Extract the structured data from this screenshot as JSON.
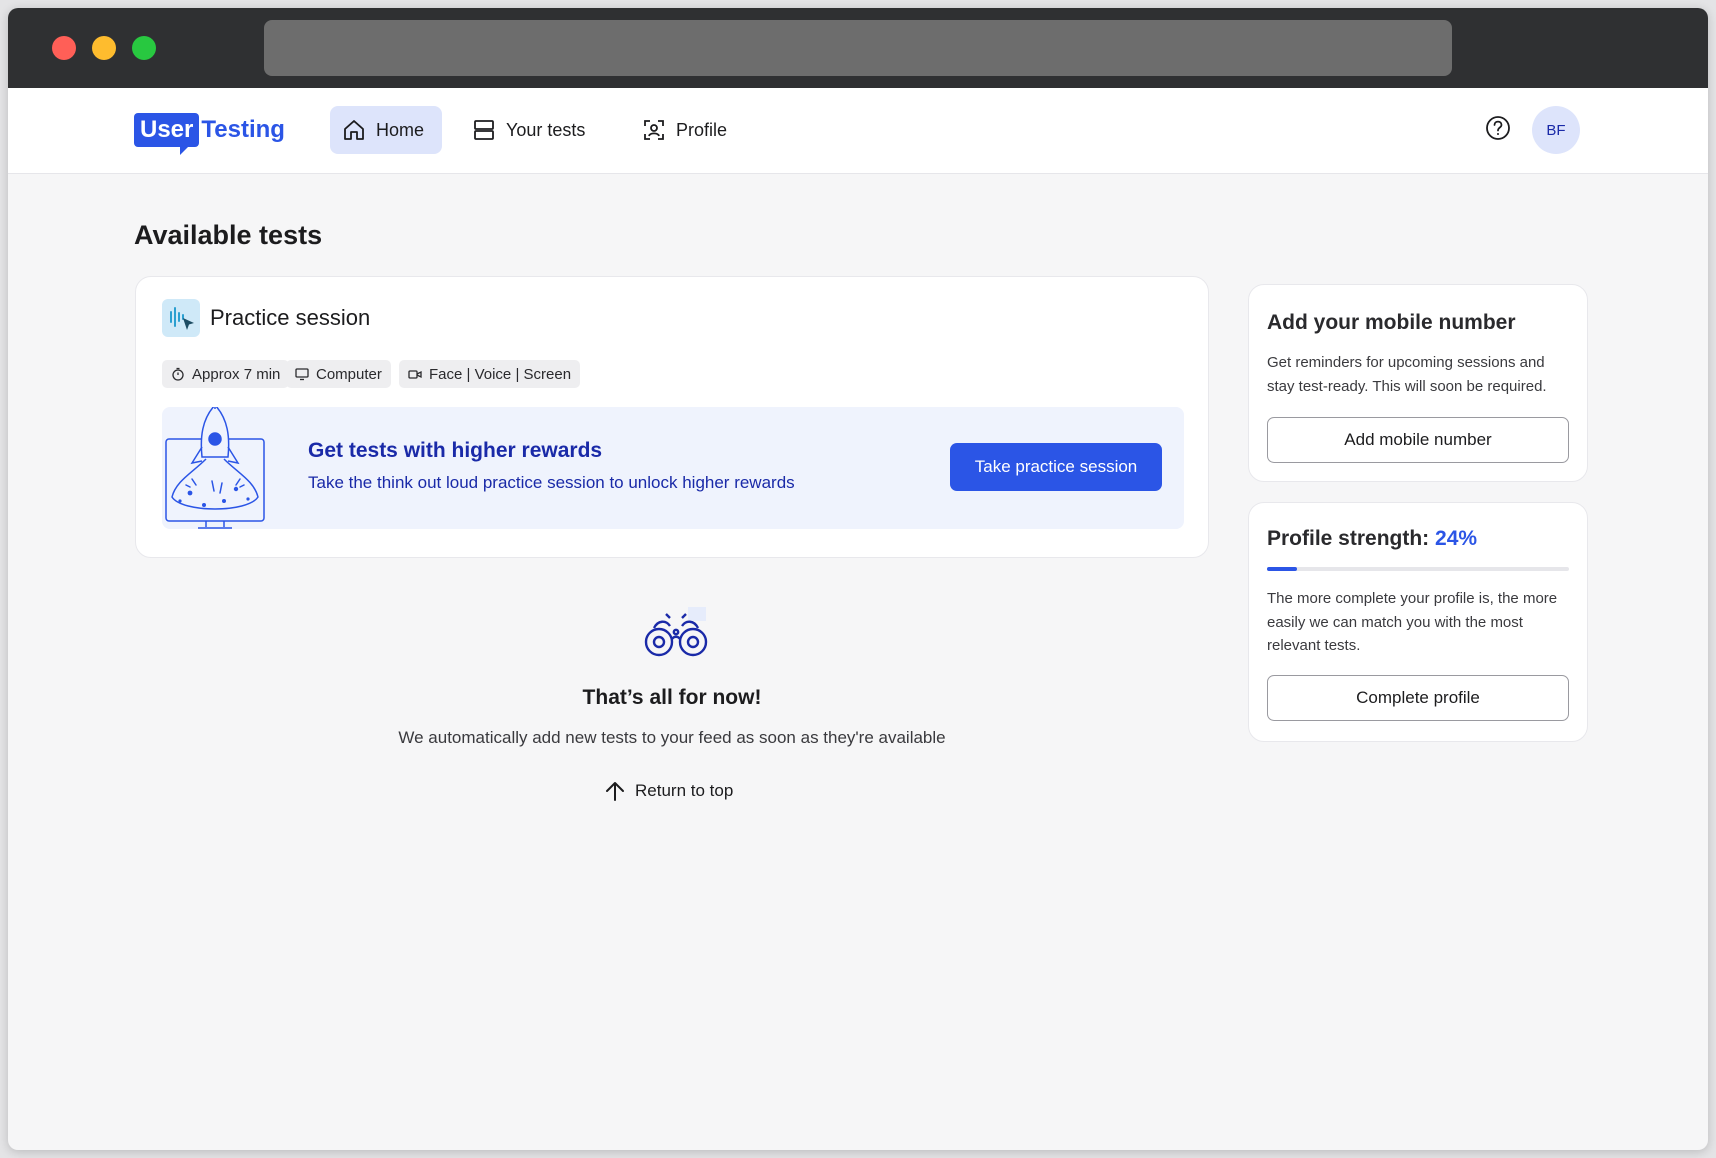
{
  "logo": {
    "part1": "User",
    "part2": "Testing"
  },
  "nav": {
    "home": "Home",
    "your_tests": "Your tests",
    "profile": "Profile",
    "avatar_initials": "BF"
  },
  "page": {
    "title": "Available tests"
  },
  "practice": {
    "title": "Practice session",
    "tags": {
      "time": "Approx 7 min",
      "device": "Computer",
      "media": "Face | Voice | Screen"
    },
    "banner": {
      "title": "Get tests with higher rewards",
      "subtitle": "Take the think out loud practice session to unlock higher rewards",
      "button": "Take practice session"
    }
  },
  "empty": {
    "title": "That’s all for now!",
    "subtitle": "We automatically add new tests to your feed as soon as they're available",
    "return_top": "Return to top"
  },
  "mobile": {
    "title": "Add your mobile number",
    "text": "Get reminders for upcoming sessions and stay test-ready. This will soon be required.",
    "button": "Add mobile number"
  },
  "strength": {
    "label": "Profile strength:",
    "percent_text": "24%",
    "progress": 0.1,
    "text": "The more complete your profile is, the more easily we can match you with the most relevant tests.",
    "button": "Complete profile"
  },
  "colors": {
    "brand": "#2b55e6",
    "brand_dark": "#1a2aa8",
    "nav_active": "#dde4fb",
    "banner_bg": "#eff3fd"
  }
}
